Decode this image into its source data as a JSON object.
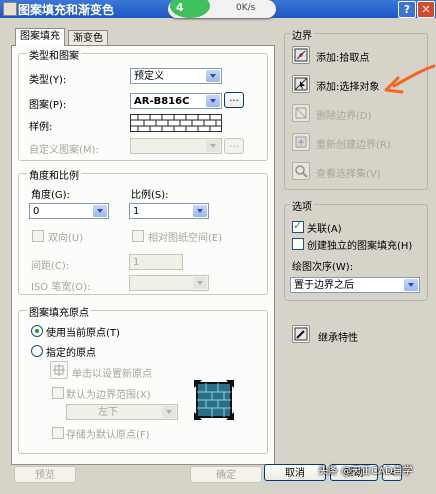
{
  "window": {
    "title": "图案填充和渐变色",
    "help": "?",
    "close": "✕"
  },
  "overlay": {
    "percent": "4",
    "rate": "0K/s"
  },
  "tabs": [
    "图案填充",
    "渐变色"
  ],
  "type_pattern": {
    "legend": "类型和图案",
    "type_label": "类型(Y):",
    "type_value": "预定义",
    "pattern_label": "图案(P):",
    "pattern_value": "AR-B816C",
    "pattern_browse": "...",
    "sample_label": "样例:",
    "custom_label": "自定义图案(M):",
    "custom_browse": "..."
  },
  "angle_scale": {
    "legend": "角度和比例",
    "angle_label": "角度(G):",
    "angle_value": "0",
    "scale_label": "比例(S):",
    "scale_value": "1",
    "double_label": "双向(U)",
    "relative_label": "相对图纸空间(E)",
    "spacing_label": "间距(C):",
    "spacing_value": "1",
    "iso_label": "ISO 笔宽(O):"
  },
  "origin": {
    "legend": "图案填充原点",
    "use_current": "使用当前原点(T)",
    "specified": "指定的原点",
    "click_set": "单击以设置新原点",
    "default_extent": "默认为边界范围(X)",
    "extent_value": "左下",
    "store_default": "存储为默认原点(F)"
  },
  "boundaries": {
    "legend": "边界",
    "add_pick": "添加:拾取点",
    "add_select": "添加:选择对象",
    "remove": "删除边界(D)",
    "recreate": "重新创建边界(R)",
    "view": "查看选择集(V)"
  },
  "options": {
    "legend": "选项",
    "associative": "关联(A)",
    "independent": "创建独立的图案填充(H)",
    "draw_order_label": "绘图次序(W):",
    "draw_order_value": "置于边界之后"
  },
  "inherit": "继承特性",
  "footer": {
    "preview": "预览",
    "ok": "确定",
    "cancel": "取消",
    "help": "帮助"
  },
  "watermark": "头条 @天正CAD自学"
}
